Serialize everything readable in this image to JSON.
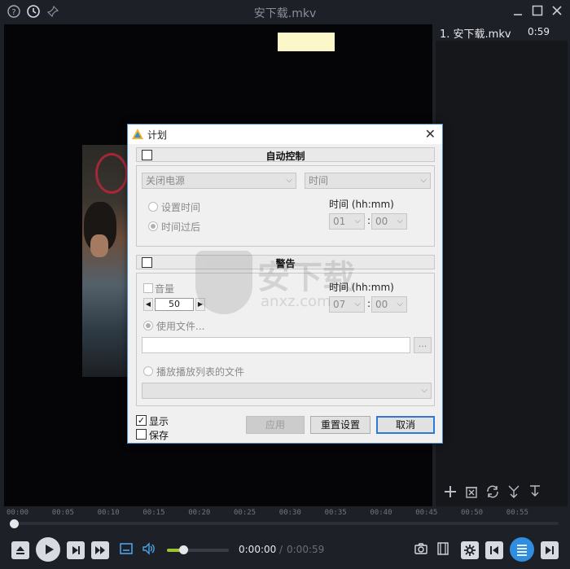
{
  "window": {
    "title": "安下载.mkv"
  },
  "playlist": {
    "items": [
      {
        "label": "1. 安下载.mkv",
        "duration": "0:59"
      }
    ]
  },
  "timeline": {
    "ticks": [
      "00:00",
      "00:05",
      "00:10",
      "00:15",
      "00:20",
      "00:25",
      "00:30",
      "00:35",
      "00:40",
      "00:45",
      "00:50",
      "00:55"
    ],
    "position_fraction": 0.0
  },
  "controls": {
    "current_time": "0:00:00",
    "separator": "/",
    "total_time": "0:00:59",
    "volume_fraction": 0.25
  },
  "dialog": {
    "title": "计划",
    "close_glyph": "✕",
    "auto_control": {
      "header": "自动控制",
      "action_select": "关闭电源",
      "mode_select": "时间",
      "option_set_time": "设置时间",
      "option_after_time": "时间过后",
      "time_label": "时间 (hh:mm)",
      "hour": "01",
      "minute": "00",
      "colon": ":"
    },
    "alarm": {
      "header": "警告",
      "volume_label": "音量",
      "volume_value": "50",
      "time_label": "时间 (hh:mm)",
      "hour": "07",
      "minute": "00",
      "colon": ":",
      "use_file_label": "使用文件...",
      "file_path": "",
      "browse_label": "...",
      "playlist_file_label": "播放播放列表的文件",
      "playlist_select": ""
    },
    "footer": {
      "show_label": "显示",
      "show_checked": true,
      "save_label": "保存",
      "save_checked": false,
      "apply_button": "应用",
      "reset_button": "重置设置",
      "cancel_button": "取消"
    }
  },
  "watermark": {
    "text": "安下载",
    "sub": "anxz.com"
  },
  "colors": {
    "accent": "#2f8ee0",
    "volume": "#9ac431",
    "dialog_border": "#4d8fd1"
  }
}
